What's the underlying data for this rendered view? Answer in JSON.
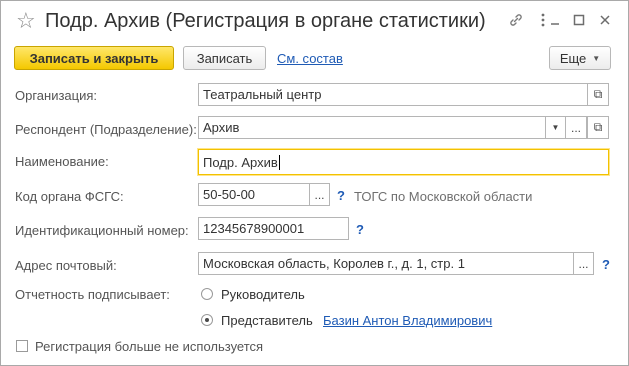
{
  "window": {
    "title": "Подр. Архив (Регистрация в органе статистики)"
  },
  "toolbar": {
    "save_close_label": "Записать и закрыть",
    "save_label": "Записать",
    "contents_link": "См. состав",
    "more_label": "Еще"
  },
  "form": {
    "organization": {
      "label": "Организация:",
      "value": "Театральный центр"
    },
    "respondent": {
      "label": "Респондент (Подразделение):",
      "value": "Архив"
    },
    "name": {
      "label": "Наименование:",
      "value": "Подр. Архив"
    },
    "fsgs_code": {
      "label": "Код органа ФСГС:",
      "value": "50-50-00",
      "help": "?",
      "hint": "ТОГС по Московской области"
    },
    "id_number": {
      "label": "Идентификационный номер:",
      "value": "12345678900001",
      "help": "?"
    },
    "postal_address": {
      "label": "Адрес почтовый:",
      "value": "Московская область, Королев г., д. 1, стр. 1",
      "help": "?"
    },
    "signer": {
      "label": "Отчетность подписывает:",
      "options": [
        "Руководитель",
        "Представитель"
      ],
      "selected": "Представитель",
      "representative_name": "Базин Антон Владимирович"
    },
    "not_used": {
      "label": "Регистрация больше не используется",
      "checked": false
    }
  },
  "colors": {
    "primary_button": "#f4c800",
    "link": "#1f5bb5",
    "focus_border": "#f2c200"
  },
  "icons": [
    "star-icon",
    "link-icon",
    "more-vert-icon",
    "minimize-icon",
    "maximize-icon",
    "close-icon",
    "dropdown-arrow-icon",
    "ellipsis-icon",
    "open-icon"
  ]
}
